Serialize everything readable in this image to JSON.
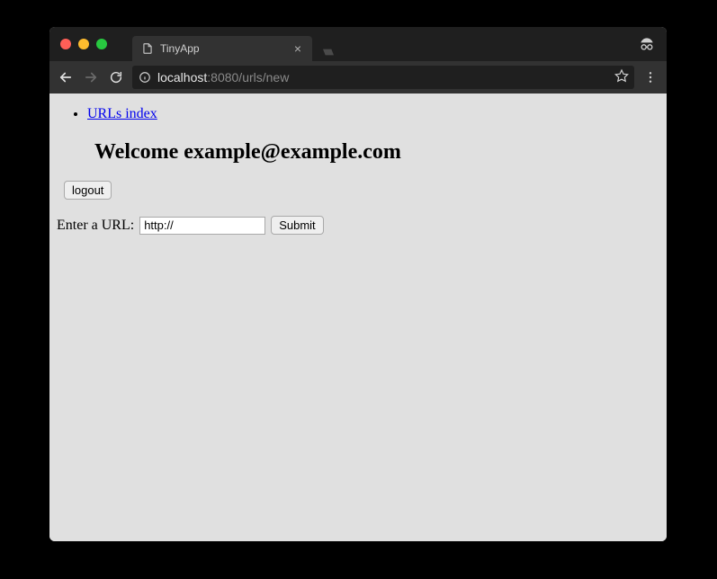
{
  "browser": {
    "tab_title": "TinyApp",
    "url_host": "localhost",
    "url_rest": ":8080/urls/new"
  },
  "page": {
    "nav_link": "URLs index",
    "welcome_prefix": "Welcome ",
    "user_email": "example@example.com",
    "logout_label": "logout",
    "form_label": "Enter a URL:",
    "url_input_value": "http://",
    "submit_label": "Submit"
  }
}
